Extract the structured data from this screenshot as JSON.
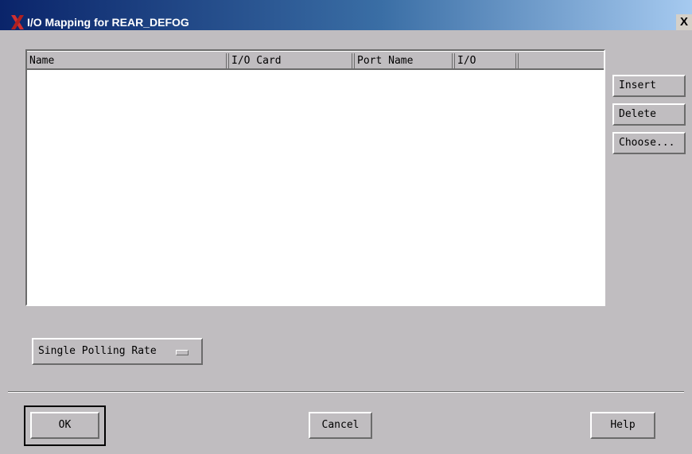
{
  "window": {
    "title": "I/O Mapping for REAR_DEFOG",
    "close_glyph": "X"
  },
  "table": {
    "columns": [
      "Name",
      "I/O Card",
      "Port Name",
      "I/O",
      ""
    ],
    "rows": []
  },
  "side_buttons": {
    "insert": "Insert",
    "delete": "Delete",
    "choose": "Choose..."
  },
  "polling": {
    "selected": "Single Polling Rate"
  },
  "bottom_buttons": {
    "ok": "OK",
    "cancel": "Cancel",
    "help": "Help"
  },
  "colors": {
    "window_bg": "#c0bdc0",
    "title_gradient_start": "#0a246a",
    "title_gradient_end": "#a6caf0",
    "app_icon": "#d03030"
  }
}
